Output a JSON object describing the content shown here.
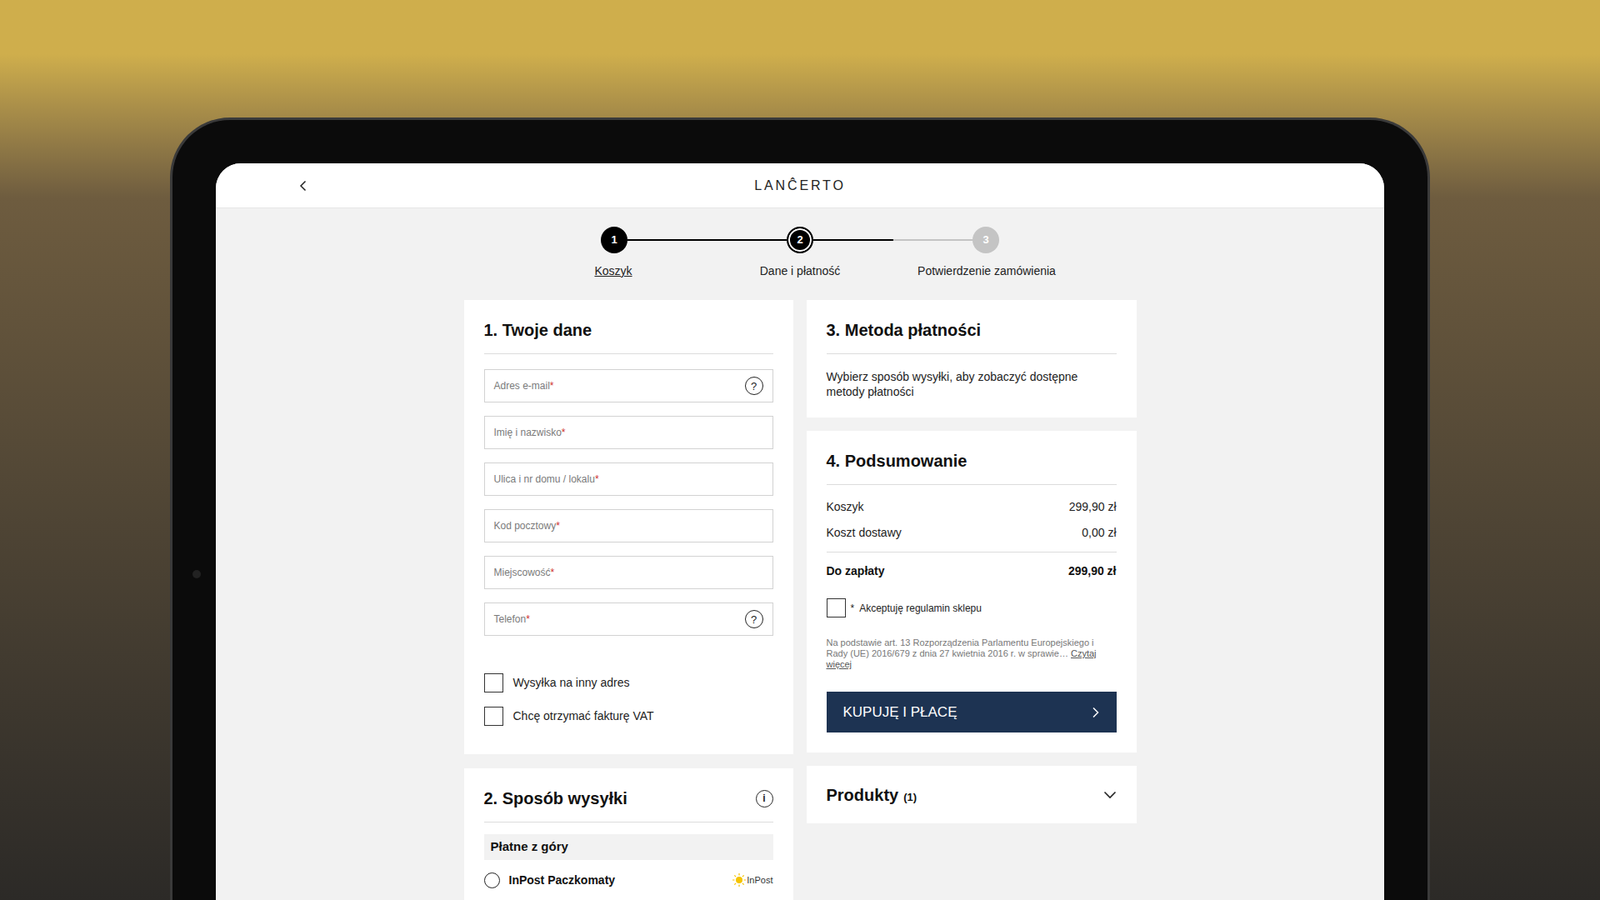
{
  "header": {
    "logo": "LANĈERTO"
  },
  "steps": [
    {
      "number": "1",
      "label": "Koszyk",
      "status": "done"
    },
    {
      "number": "2",
      "label": "Dane i płatność",
      "status": "current"
    },
    {
      "number": "3",
      "label": "Potwierdzenie zamówienia",
      "status": "upcoming"
    }
  ],
  "connectors": [
    {
      "level": 1
    },
    {
      "level": 0.5
    }
  ],
  "your_data": {
    "title": "1. Twoje dane",
    "required_mark": "*",
    "help_glyph": "?",
    "fields": [
      {
        "placeholder": "Adres e-mail",
        "required": true,
        "help": true
      },
      {
        "placeholder": "Imię i nazwisko",
        "required": true,
        "help": false
      },
      {
        "placeholder": "Ulica i nr domu / lokalu",
        "required": true,
        "help": false
      },
      {
        "placeholder": "Kod pocztowy",
        "required": true,
        "help": false
      },
      {
        "placeholder": "Miejscowość",
        "required": true,
        "help": false
      },
      {
        "placeholder": "Telefon",
        "required": true,
        "help": true
      }
    ],
    "checkboxes": [
      {
        "label": "Wysyłka na inny adres",
        "checked": false
      },
      {
        "label": "Chcę otrzymać fakturę VAT",
        "checked": false
      }
    ]
  },
  "shipping": {
    "title": "2. Sposób wysyłki",
    "info_glyph": "i",
    "group_label": "Płatne z góry",
    "options": [
      {
        "label": "InPost Paczkomaty",
        "logo": "InPost",
        "selected": false
      }
    ]
  },
  "payment": {
    "title": "3. Metoda płatności",
    "message": "Wybierz sposób wysyłki, aby zobaczyć dostępne metody płatności"
  },
  "summary": {
    "title": "4. Podsumowanie",
    "rows": [
      {
        "label": "Koszyk",
        "value": "299,90 zł"
      },
      {
        "label": "Koszt dostawy",
        "value": "0,00 zł"
      }
    ],
    "total": {
      "label": "Do zapłaty",
      "value": "299,90 zł"
    },
    "terms": {
      "required_mark": "*",
      "label": "Akceptuję regulamin sklepu",
      "checked": false
    },
    "gdpr": {
      "text": "Na podstawie art. 13 Rozporządzenia Parlamentu Europejskiego i Rady (UE) 2016/679 z dnia 27 kwietnia 2016 r. w sprawie…",
      "link": "Czytaj więcej"
    },
    "button": "KUPUJĘ I PŁACĘ"
  },
  "products": {
    "title": "Produkty",
    "count": "(1)",
    "expanded": false
  }
}
